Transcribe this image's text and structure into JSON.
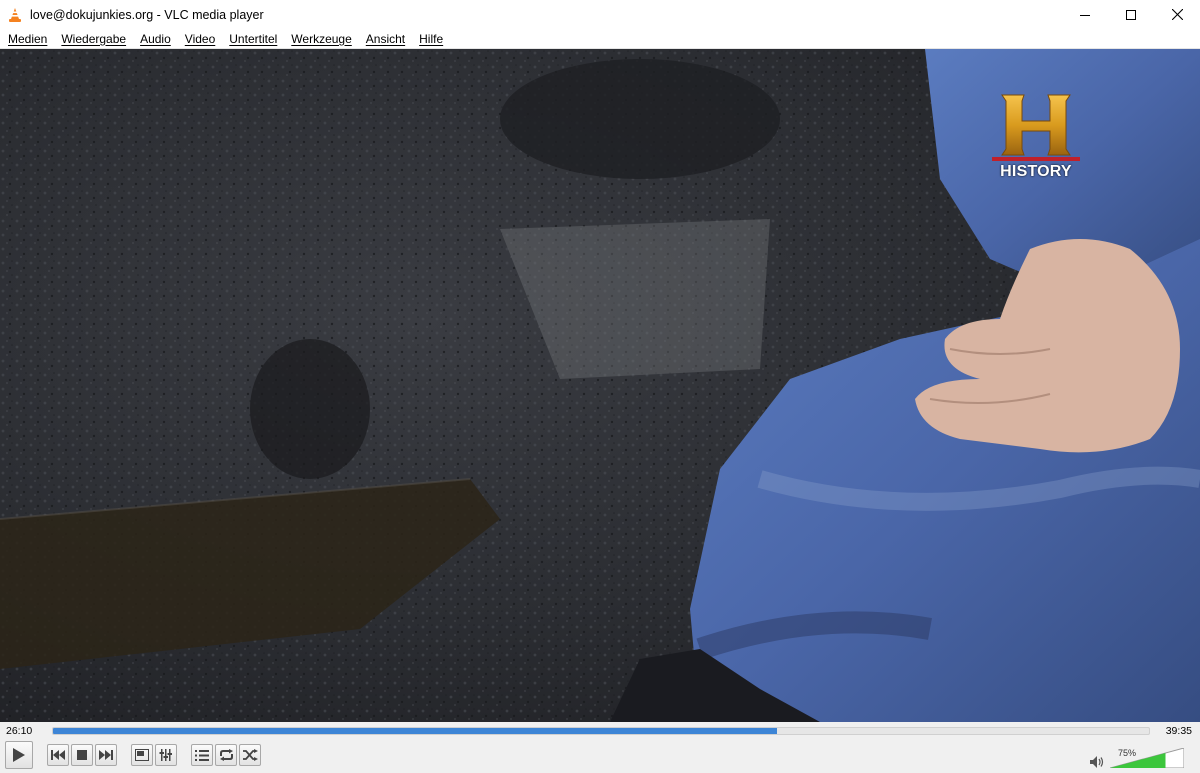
{
  "window": {
    "title": "love@dokujunkies.org - VLC media player"
  },
  "menu": {
    "items": [
      "Medien",
      "Wiedergabe",
      "Audio",
      "Video",
      "Untertitel",
      "Werkzeuge",
      "Ansicht",
      "Hilfe"
    ]
  },
  "video": {
    "channel_logo_text": "HISTORY"
  },
  "playback": {
    "elapsed": "26:10",
    "total": "39:35",
    "progress_fraction": 0.661
  },
  "volume": {
    "label": "75%",
    "level_fraction": 0.75
  },
  "colors": {
    "accent": "#3d85d6",
    "volume_green": "#3cc63c",
    "vlc_orange": "#f58220"
  },
  "icons": {
    "app": "vlc-cone-icon",
    "minimize": "minimize-icon",
    "maximize": "maximize-icon",
    "close": "close-icon",
    "play": "play-icon",
    "prev": "previous-icon",
    "stop": "stop-icon",
    "next": "next-icon",
    "fullscreen": "fullscreen-icon",
    "extended": "extended-settings-icon",
    "playlist": "playlist-icon",
    "loop": "loop-icon",
    "shuffle": "shuffle-icon",
    "speaker": "speaker-icon"
  }
}
